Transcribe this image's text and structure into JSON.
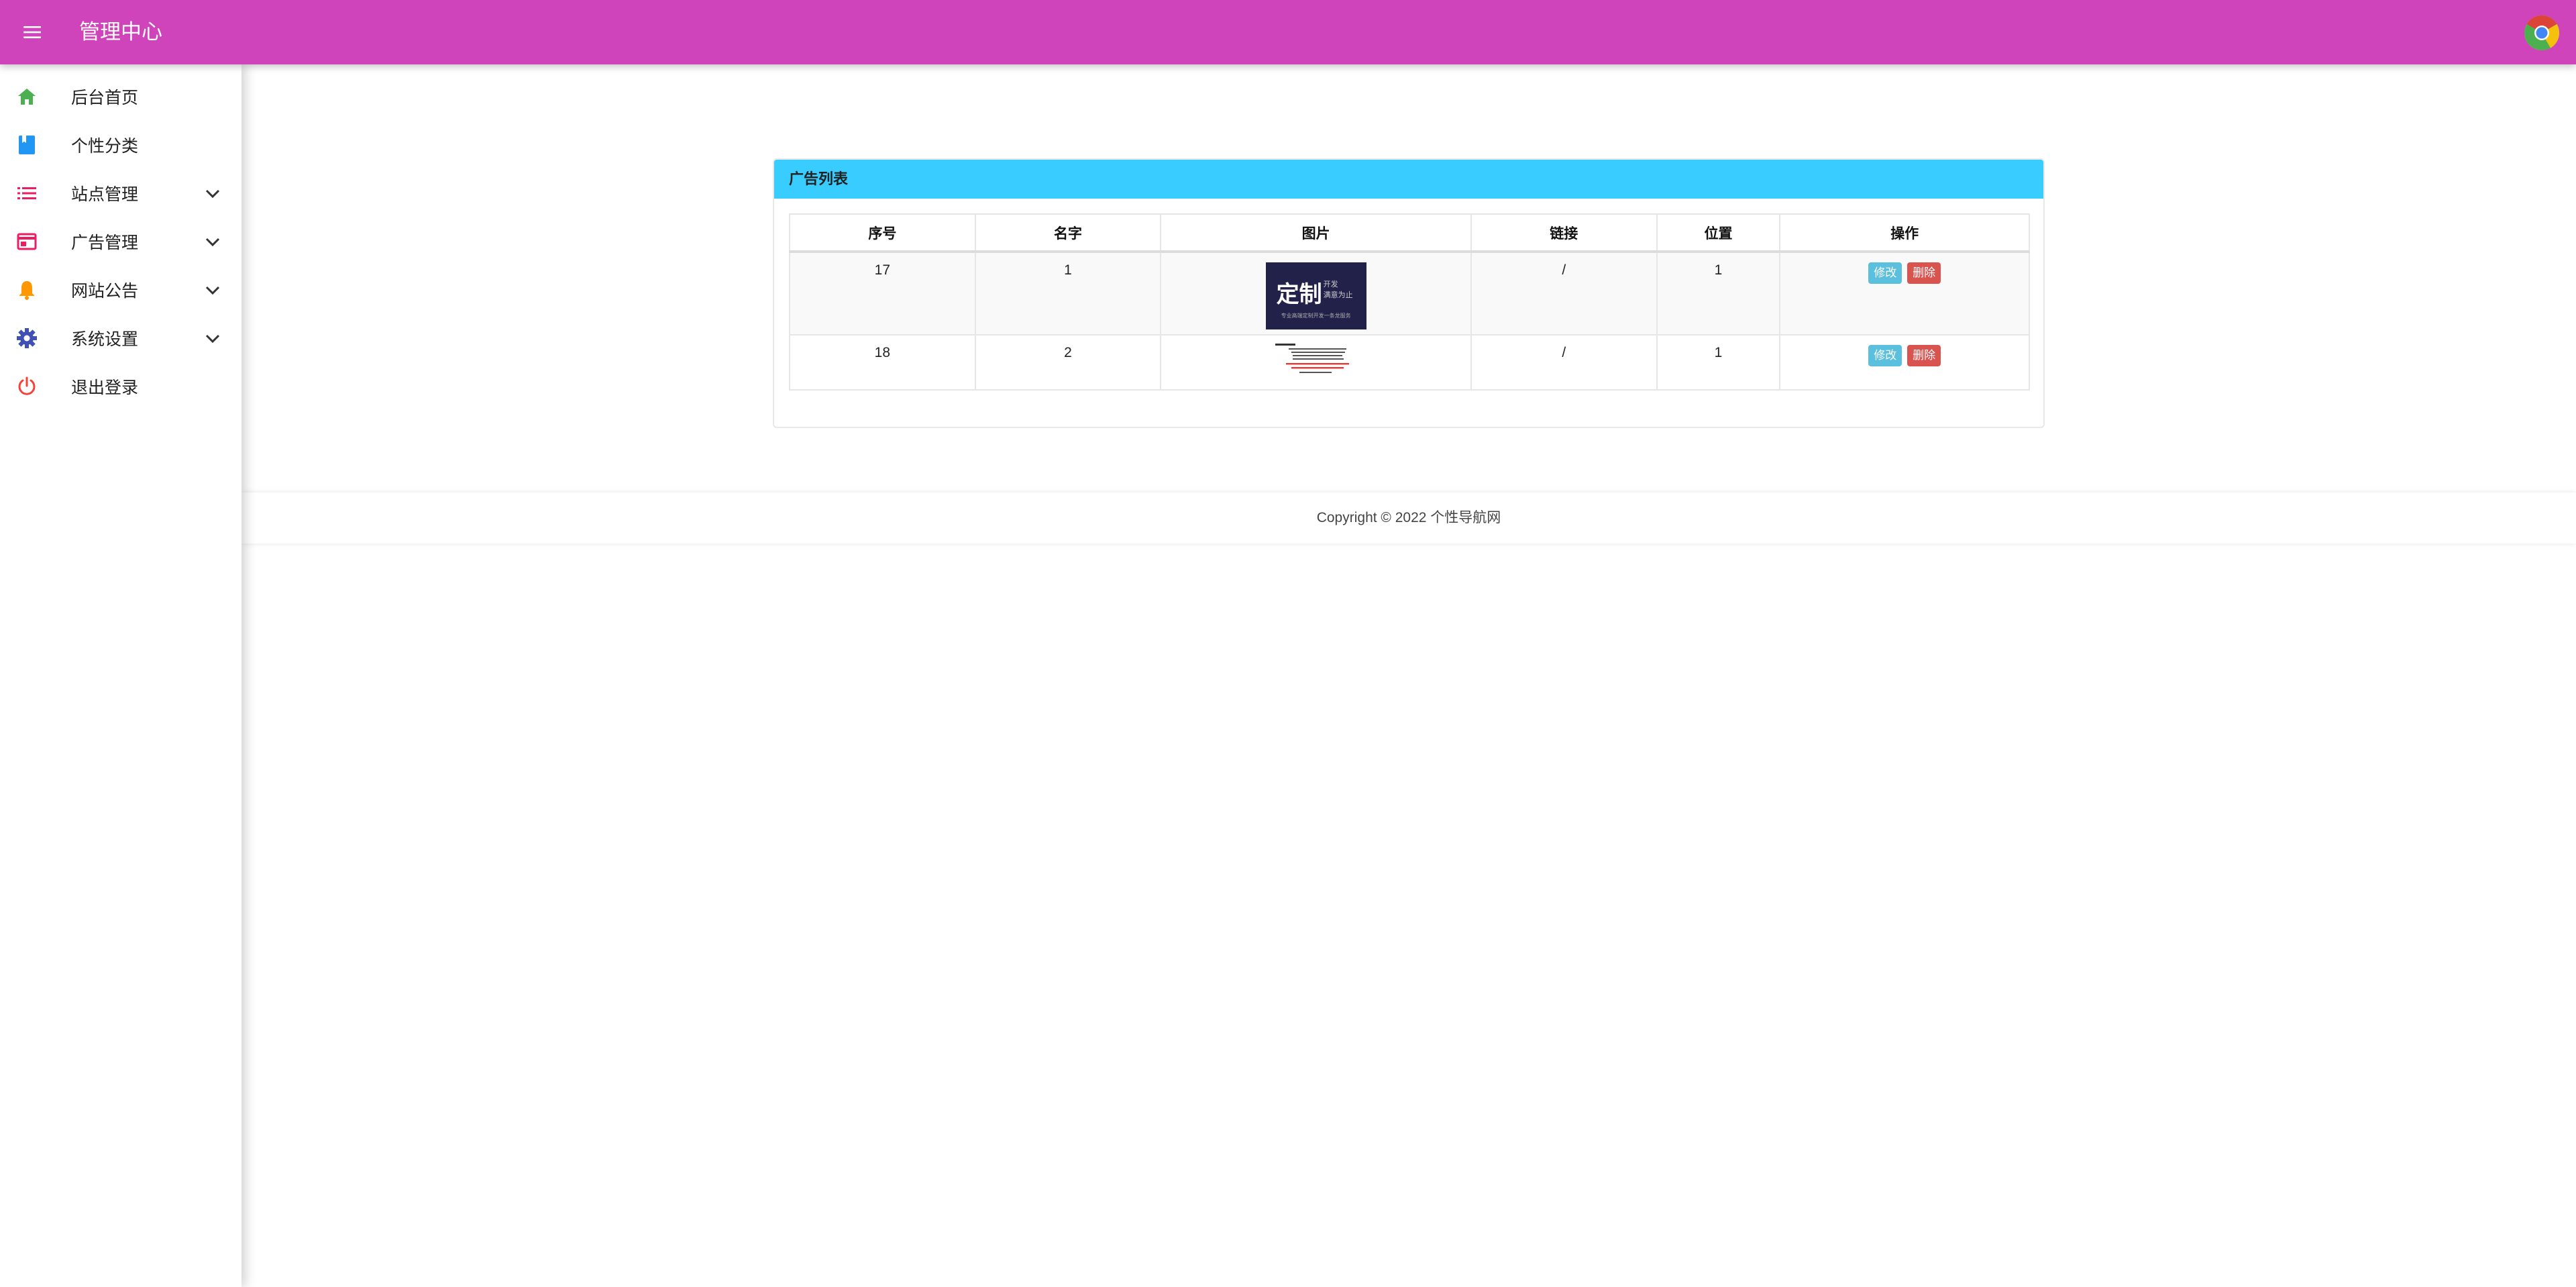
{
  "header": {
    "title": "管理中心",
    "menu_icon": "menu-icon",
    "avatar_icon": "chrome-icon",
    "bar_color": "#cf44bb"
  },
  "sidebar": {
    "items": [
      {
        "label": "后台首页",
        "icon": "home-icon",
        "color": "#4caf50",
        "expandable": false
      },
      {
        "label": "个性分类",
        "icon": "bookmark-icon",
        "color": "#2196f3",
        "expandable": false
      },
      {
        "label": "站点管理",
        "icon": "list-icon",
        "color": "#e91e63",
        "expandable": true
      },
      {
        "label": "广告管理",
        "icon": "ad-icon",
        "color": "#e91e63",
        "expandable": true
      },
      {
        "label": "网站公告",
        "icon": "bell-icon",
        "color": "#ff9800",
        "expandable": true
      },
      {
        "label": "系统设置",
        "icon": "gear-icon",
        "color": "#3f51b5",
        "expandable": true
      },
      {
        "label": "退出登录",
        "icon": "power-icon",
        "color": "#f44336",
        "expandable": false
      }
    ]
  },
  "panel": {
    "title": "广告列表",
    "header_color": "#38ccff"
  },
  "table": {
    "columns": [
      "序号",
      "名字",
      "图片",
      "链接",
      "位置",
      "操作"
    ],
    "rows": [
      {
        "id": "17",
        "name": "1",
        "link": "/",
        "position": "1",
        "edit": "修改",
        "delete": "删除"
      },
      {
        "id": "18",
        "name": "2",
        "link": "/",
        "position": "1",
        "edit": "修改",
        "delete": "删除"
      }
    ]
  },
  "ad_image_1": {
    "main_text": "定制",
    "side_line_1": "开发",
    "side_line_2": "满意为止",
    "bottom_text": "专业高端定制开发一条龙服务"
  },
  "footer": {
    "copyright": "Copyright © 2022 个性导航网"
  }
}
